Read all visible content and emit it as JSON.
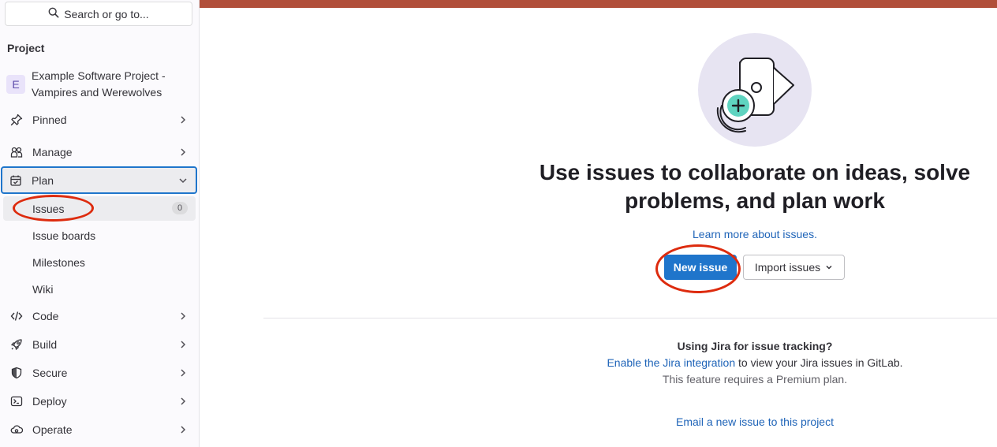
{
  "sidebar": {
    "search_placeholder": "Search or go to...",
    "section_title": "Project",
    "project": {
      "avatar_letter": "E",
      "name": "Example Software Project - Vampires and Werewolves"
    },
    "items": [
      {
        "label": "Pinned",
        "icon": "pin-icon"
      },
      {
        "label": "Manage",
        "icon": "users-icon"
      },
      {
        "label": "Plan",
        "icon": "calendar-icon",
        "expanded": true
      },
      {
        "label": "Code",
        "icon": "code-icon"
      },
      {
        "label": "Build",
        "icon": "rocket-icon"
      },
      {
        "label": "Secure",
        "icon": "shield-icon"
      },
      {
        "label": "Deploy",
        "icon": "deploy-icon"
      },
      {
        "label": "Operate",
        "icon": "cloud-gear-icon"
      }
    ],
    "plan_subitems": [
      {
        "label": "Issues",
        "count": "0",
        "active": true
      },
      {
        "label": "Issue boards"
      },
      {
        "label": "Milestones"
      },
      {
        "label": "Wiki"
      }
    ]
  },
  "colors": {
    "accent": "#1f75cb",
    "topbar": "#b14f3a",
    "annotation": "#dd2b0e"
  },
  "main": {
    "headline": "Use issues to collaborate on ideas, solve problems, and plan work",
    "learn_more": "Learn more about issues.",
    "new_issue_button": "New issue",
    "import_issues_button": "Import issues",
    "jira": {
      "title": "Using Jira for issue tracking?",
      "link": "Enable the Jira integration",
      "rest": " to view your Jira issues in GitLab.",
      "note": "This feature requires a Premium plan."
    },
    "email_link": "Email a new issue to this project"
  }
}
